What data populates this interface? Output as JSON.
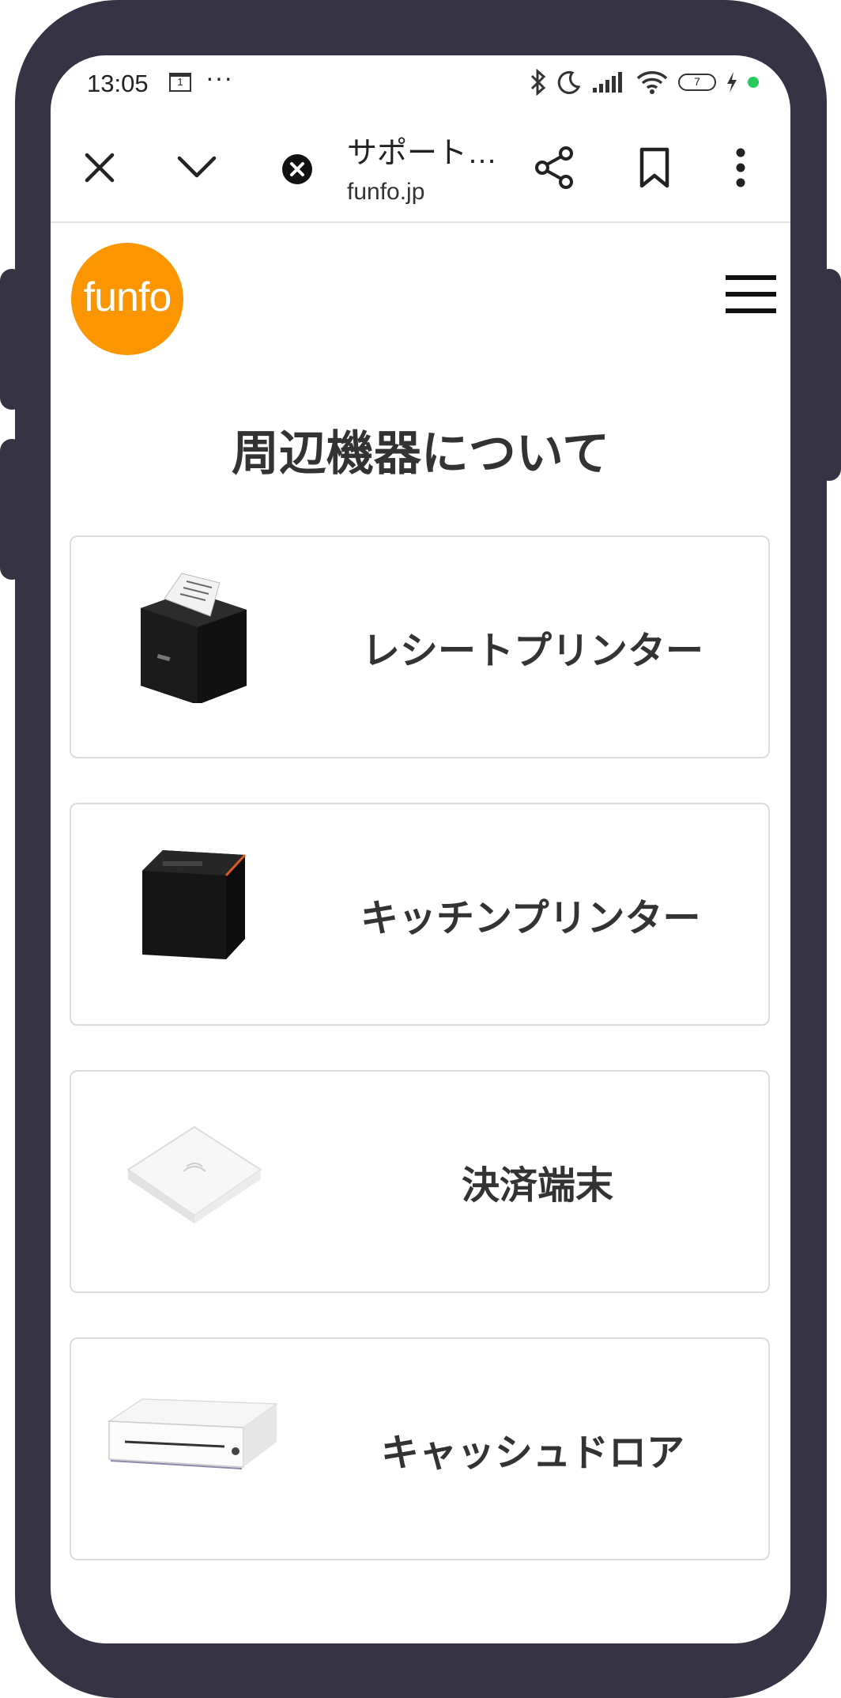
{
  "status_bar": {
    "time": "13:05",
    "calendar_day": "1",
    "more": "···",
    "battery_level": "7"
  },
  "browser": {
    "title": "サポート…",
    "url": "funfo.jp"
  },
  "site": {
    "logo_text": "funfo",
    "brand_color": "#fb9600"
  },
  "page": {
    "title": "周辺機器について",
    "cards": [
      {
        "label": "レシートプリンター",
        "image": "receipt-printer"
      },
      {
        "label": "キッチンプリンター",
        "image": "kitchen-printer"
      },
      {
        "label": "決済端末",
        "image": "payment-terminal"
      },
      {
        "label": "キャッシュドロア",
        "image": "cash-drawer"
      }
    ]
  }
}
